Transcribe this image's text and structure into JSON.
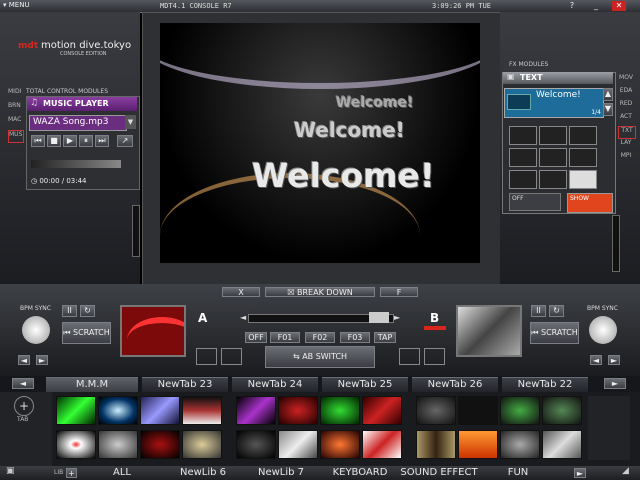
{
  "top": {
    "menu": "MENU",
    "console_title": "MDT4.1 CONSOLE R7",
    "time": "3:09:26 PM TUE",
    "window_controls": [
      "?",
      "_",
      "X"
    ]
  },
  "logo": {
    "brand": "motion dive.tokyo",
    "edition": "CONSOLE EDITION"
  },
  "left": {
    "modules_label": "TOTAL CONTROL MODULES",
    "side_tabs": [
      "MIDI",
      "BRN",
      "MAC",
      "MUS"
    ],
    "music_player": {
      "title": "MUSIC PLAYER",
      "song": "WAZA Song.mp3",
      "time": "00:00 / 03:44"
    }
  },
  "fx": {
    "label": "FX MODULES",
    "title": "TEXT",
    "text_value": "Welcome!",
    "page": "1/4",
    "off": "OFF",
    "show": "SHOW",
    "side_tabs": [
      "MOV",
      "EDA",
      "RED",
      "ACT",
      "TXT",
      "LAY",
      "MPI"
    ]
  },
  "preview": {
    "texts": [
      "Welcome!",
      "Welcome!",
      "Welcome!"
    ]
  },
  "center": {
    "x_left": "X",
    "break_down": "BREAK DOWN",
    "f_right": "F",
    "deck_a": "A",
    "deck_b": "B",
    "buttons": [
      "OFF",
      "F01",
      "F02",
      "F03",
      "TAP"
    ],
    "ab_switch": "AB SWITCH"
  },
  "decks": {
    "bpm_sync": "BPM SYNC",
    "scratch": "SCRATCH"
  },
  "tabs": [
    "M.M.M",
    "NewTab 23",
    "NewTab 24",
    "NewTab 25",
    "NewTab 26",
    "NewTab 22"
  ],
  "tab_label": "TAB",
  "library": {
    "lib_label": "LIB",
    "tabs": [
      "ALL",
      "NewLib 6",
      "NewLib 7",
      "KEYBOARD",
      "SOUND EFFECT",
      "FUN"
    ]
  },
  "colors": {
    "accent_red": "#d8261f",
    "panel": "#3a3d42",
    "screen_blue": "#1d6c9a"
  }
}
